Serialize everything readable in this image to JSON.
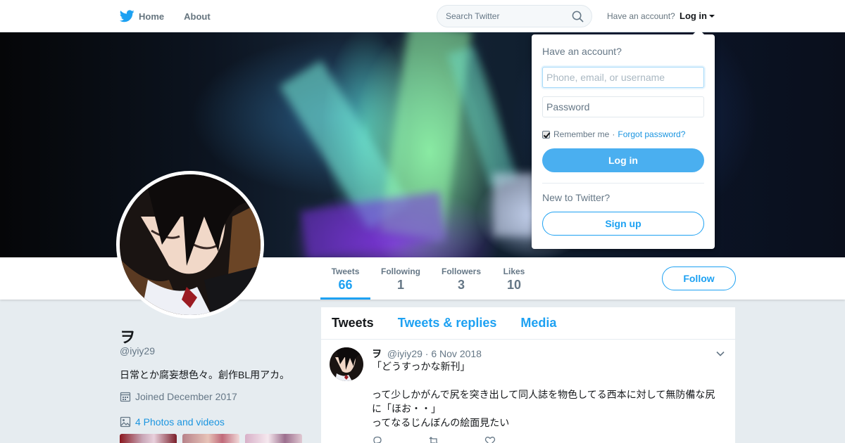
{
  "nav": {
    "home_label": "Home",
    "about_label": "About",
    "search_placeholder": "Search Twitter",
    "have_account_label": "Have an account?",
    "login_label": "Log in"
  },
  "login_dropdown": {
    "title": "Have an account?",
    "username_placeholder": "Phone, email, or username",
    "password_placeholder": "Password",
    "remember_label": "Remember me",
    "separator": "·",
    "forgot_label": "Forgot password?",
    "remember_checked": true,
    "login_button": "Log in",
    "new_label": "New to Twitter?",
    "signup_button": "Sign up"
  },
  "profile_nav": {
    "stats": [
      {
        "label": "Tweets",
        "value": "66",
        "active": true
      },
      {
        "label": "Following",
        "value": "1",
        "active": false
      },
      {
        "label": "Followers",
        "value": "3",
        "active": false
      },
      {
        "label": "Likes",
        "value": "10",
        "active": false
      }
    ],
    "follow_button": "Follow"
  },
  "profile": {
    "name": "ヲ",
    "handle": "@iyiy29",
    "bio": "日常とか腐妄想色々。創作BL用アカ。",
    "joined": "Joined December 2017",
    "photos_label": "4 Photos and videos"
  },
  "timeline": {
    "tabs": [
      {
        "label": "Tweets",
        "active": true
      },
      {
        "label": "Tweets & replies",
        "active": false
      },
      {
        "label": "Media",
        "active": false
      }
    ],
    "tweets": [
      {
        "name": "ヲ",
        "handle": "@iyiy29",
        "separator": "·",
        "date": "6 Nov 2018",
        "text": "「どうすっかな新刊」\n\nって少しかがんで尻を突き出して同人誌を物色してる西本に対して無防備な尻に「ほお・・」\nってなるじんぼんの絵面見たい"
      }
    ]
  },
  "colors": {
    "accent": "#1da1f2",
    "link": "#1b95e0",
    "background": "#e6ecf0",
    "muted_text": "#657786"
  },
  "icons": [
    "twitter-bird-icon",
    "search-icon",
    "caret-down-icon",
    "calendar-icon",
    "photo-icon",
    "chevron-down-icon",
    "reply-icon",
    "retweet-icon",
    "like-icon"
  ]
}
